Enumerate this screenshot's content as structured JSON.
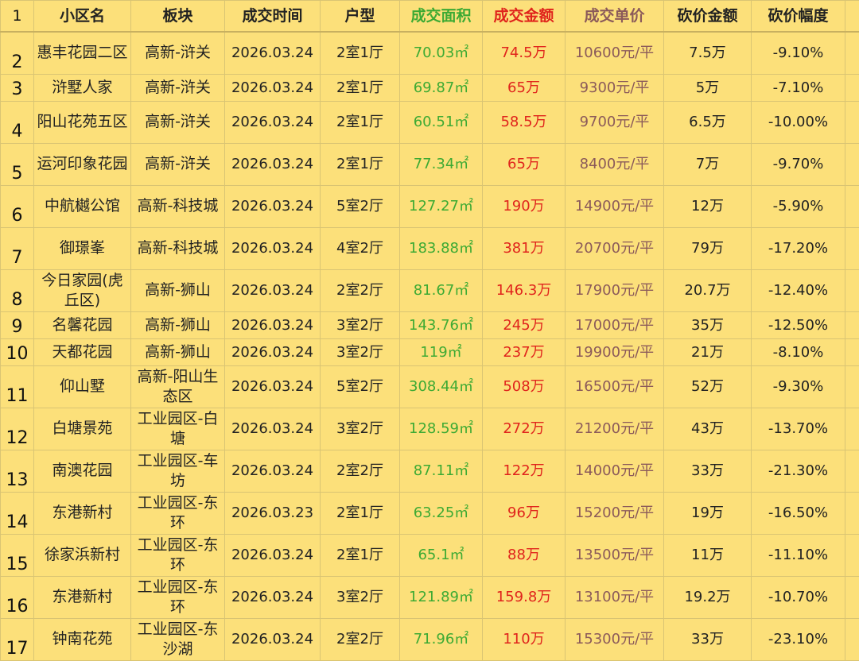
{
  "table": {
    "header_row_number": "1",
    "headers": [
      "小区名",
      "板块",
      "成交时间",
      "户型",
      "成交面积",
      "成交金额",
      "成交单价",
      "砍价金额",
      "砍价幅度"
    ],
    "header_colors": [
      "#222222",
      "#222222",
      "#222222",
      "#222222",
      "#3DAA33",
      "#E0241C",
      "#8B5A5A",
      "#222222",
      "#222222"
    ],
    "rows": [
      {
        "num": "2",
        "name": "惠丰花园二区",
        "block": "高新-浒关",
        "date": "2026.03.24",
        "layout": "2室1厅",
        "area": "70.03㎡",
        "amount": "74.5万",
        "unit": "10600元/平",
        "cut": "7.5万",
        "pct": "-9.10%"
      },
      {
        "num": "3",
        "name": "浒墅人家",
        "block": "高新-浒关",
        "date": "2026.03.24",
        "layout": "2室1厅",
        "area": "69.87㎡",
        "amount": "65万",
        "unit": "9300元/平",
        "cut": "5万",
        "pct": "-7.10%"
      },
      {
        "num": "4",
        "name": "阳山花苑五区",
        "block": "高新-浒关",
        "date": "2026.03.24",
        "layout": "2室1厅",
        "area": "60.51㎡",
        "amount": "58.5万",
        "unit": "9700元/平",
        "cut": "6.5万",
        "pct": "-10.00%"
      },
      {
        "num": "5",
        "name": "运河印象花园",
        "block": "高新-浒关",
        "date": "2026.03.24",
        "layout": "2室1厅",
        "area": "77.34㎡",
        "amount": "65万",
        "unit": "8400元/平",
        "cut": "7万",
        "pct": "-9.70%"
      },
      {
        "num": "6",
        "name": "中航樾公馆",
        "block": "高新-科技城",
        "date": "2026.03.24",
        "layout": "5室2厅",
        "area": "127.27㎡",
        "amount": "190万",
        "unit": "14900元/平",
        "cut": "12万",
        "pct": "-5.90%"
      },
      {
        "num": "7",
        "name": "御璟峯",
        "block": "高新-科技城",
        "date": "2026.03.24",
        "layout": "4室2厅",
        "area": "183.88㎡",
        "amount": "381万",
        "unit": "20700元/平",
        "cut": "79万",
        "pct": "-17.20%"
      },
      {
        "num": "8",
        "name": "今日家园(虎丘区)",
        "block": "高新-狮山",
        "date": "2026.03.24",
        "layout": "2室2厅",
        "area": "81.67㎡",
        "amount": "146.3万",
        "unit": "17900元/平",
        "cut": "20.7万",
        "pct": "-12.40%"
      },
      {
        "num": "9",
        "name": "名馨花园",
        "block": "高新-狮山",
        "date": "2026.03.24",
        "layout": "3室2厅",
        "area": "143.76㎡",
        "amount": "245万",
        "unit": "17000元/平",
        "cut": "35万",
        "pct": "-12.50%"
      },
      {
        "num": "10",
        "name": "天都花园",
        "block": "高新-狮山",
        "date": "2026.03.24",
        "layout": "3室2厅",
        "area": "119㎡",
        "amount": "237万",
        "unit": "19900元/平",
        "cut": "21万",
        "pct": "-8.10%"
      },
      {
        "num": "11",
        "name": "仰山墅",
        "block": "高新-阳山生态区",
        "date": "2026.03.24",
        "layout": "5室2厅",
        "area": "308.44㎡",
        "amount": "508万",
        "unit": "16500元/平",
        "cut": "52万",
        "pct": "-9.30%"
      },
      {
        "num": "12",
        "name": "白塘景苑",
        "block": "工业园区-白塘",
        "date": "2026.03.24",
        "layout": "3室2厅",
        "area": "128.59㎡",
        "amount": "272万",
        "unit": "21200元/平",
        "cut": "43万",
        "pct": "-13.70%"
      },
      {
        "num": "13",
        "name": "南澳花园",
        "block": "工业园区-车坊",
        "date": "2026.03.24",
        "layout": "2室2厅",
        "area": "87.11㎡",
        "amount": "122万",
        "unit": "14000元/平",
        "cut": "33万",
        "pct": "-21.30%"
      },
      {
        "num": "14",
        "name": "东港新村",
        "block": "工业园区-东环",
        "date": "2026.03.23",
        "layout": "2室1厅",
        "area": "63.25㎡",
        "amount": "96万",
        "unit": "15200元/平",
        "cut": "19万",
        "pct": "-16.50%"
      },
      {
        "num": "15",
        "name": "徐家浜新村",
        "block": "工业园区-东环",
        "date": "2026.03.24",
        "layout": "2室1厅",
        "area": "65.1㎡",
        "amount": "88万",
        "unit": "13500元/平",
        "cut": "11万",
        "pct": "-11.10%"
      },
      {
        "num": "16",
        "name": "东港新村",
        "block": "工业园区-东环",
        "date": "2026.03.24",
        "layout": "3室2厅",
        "area": "121.89㎡",
        "amount": "159.8万",
        "unit": "13100元/平",
        "cut": "19.2万",
        "pct": "-10.70%"
      },
      {
        "num": "17",
        "name": "钟南花苑",
        "block": "工业园区-东沙湖",
        "date": "2026.03.24",
        "layout": "2室2厅",
        "area": "71.96㎡",
        "amount": "110万",
        "unit": "15300元/平",
        "cut": "33万",
        "pct": "-23.10%"
      }
    ]
  }
}
